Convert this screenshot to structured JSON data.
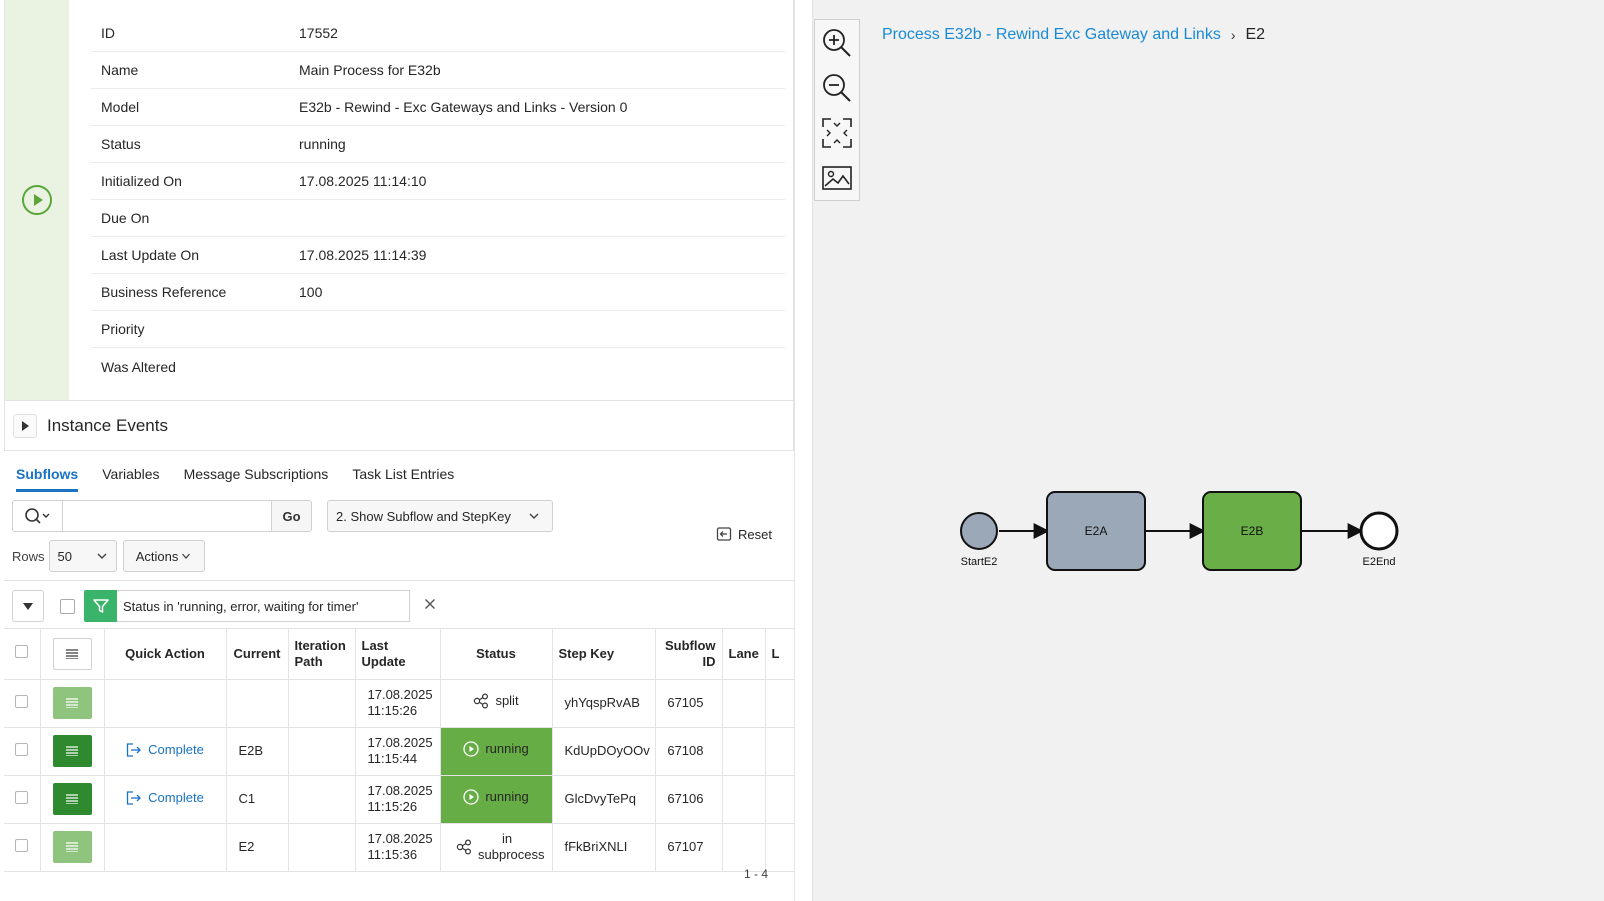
{
  "details": [
    {
      "label": "ID",
      "value": "17552"
    },
    {
      "label": "Name",
      "value": "Main Process for E32b"
    },
    {
      "label": "Model",
      "value": "E32b - Rewind - Exc Gateways and Links - Version 0"
    },
    {
      "label": "Status",
      "value": "running"
    },
    {
      "label": "Initialized On",
      "value": "17.08.2025 11:14:10"
    },
    {
      "label": "Due On",
      "value": ""
    },
    {
      "label": "Last Update On",
      "value": "17.08.2025 11:14:39"
    },
    {
      "label": "Business Reference",
      "value": "100"
    },
    {
      "label": "Priority",
      "value": ""
    },
    {
      "label": "Was Altered",
      "value": ""
    }
  ],
  "events": {
    "title": "Instance Events"
  },
  "tabs": [
    "Subflows",
    "Variables",
    "Message Subscriptions",
    "Task List Entries"
  ],
  "toolbar": {
    "search_placeholder": "",
    "go_label": "Go",
    "report": "2. Show Subflow and StepKey",
    "reset_label": "Reset",
    "rows_label": "Rows",
    "rows_value": "50",
    "actions_label": "Actions"
  },
  "filter": {
    "text": "Status in 'running, error, waiting for timer'"
  },
  "grid": {
    "headers": {
      "quick_action": "Quick Action",
      "current": "Current",
      "iteration_path": "Iteration Path",
      "last_update": "Last Update",
      "status": "Status",
      "step_key": "Step Key",
      "subflow_id": "Subflow ID",
      "lane": "Lane",
      "extra": "L"
    },
    "rows": [
      {
        "menu": "light",
        "action": "",
        "current": "",
        "iteration": "",
        "date": "17.08.2025",
        "time": "11:15:26",
        "status": "split",
        "status_type": "split",
        "step_key": "yhYqspRvAB",
        "subflow_id": "67105"
      },
      {
        "menu": "dark",
        "action": "Complete",
        "current": "E2B",
        "iteration": "",
        "date": "17.08.2025",
        "time": "11:15:44",
        "status": "running",
        "status_type": "running",
        "step_key": "KdUpDOyOOv",
        "subflow_id": "67108"
      },
      {
        "menu": "dark",
        "action": "Complete",
        "current": "C1",
        "iteration": "",
        "date": "17.08.2025",
        "time": "11:15:26",
        "status": "running",
        "status_type": "running",
        "step_key": "GlcDvyTePq",
        "subflow_id": "67106"
      },
      {
        "menu": "light",
        "action": "",
        "current": "E2",
        "iteration": "",
        "date": "17.08.2025",
        "time": "11:15:36",
        "status": "in subprocess",
        "status_type": "subprocess",
        "step_key": "fFkBriXNLI",
        "subflow_id": "67107"
      }
    ],
    "pagination": "1 - 4"
  },
  "breadcrumb": {
    "link": "Process E32b - Rewind Exc Gateway and Links",
    "current": "E2"
  },
  "diagram": {
    "start": "StartE2",
    "task1": "E2A",
    "task2": "E2B",
    "end": "E2End",
    "colors": {
      "task1": "#9aa8b8",
      "task2": "#6aae47",
      "start": "#9aa8b8"
    }
  },
  "icons": [
    "play-circle-icon",
    "search-icon",
    "chevron-down-icon",
    "reset-icon",
    "filter-icon",
    "close-icon",
    "row-menu-icon",
    "complete-icon",
    "split-icon",
    "zoom-in-icon",
    "zoom-out-icon",
    "fit-icon",
    "export-image-icon"
  ]
}
